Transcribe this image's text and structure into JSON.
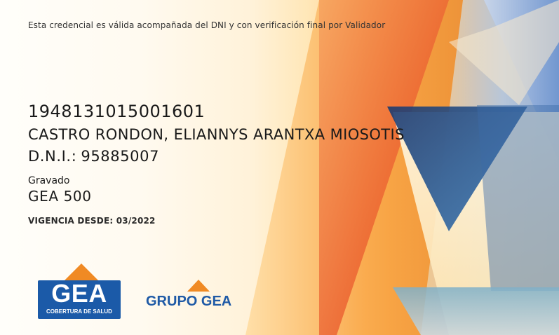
{
  "card": {
    "notice": "Esta credencial es válida acompañada del DNI y con verificación final por Validador",
    "member_number": "1948131015001601",
    "holder_name": "CASTRO RONDON, ELIANNYS ARANTXA MIOSOTIS",
    "dni_label": "D.N.I.:",
    "dni_value": "95885007",
    "plan_label": "Gravado",
    "plan_value": "GEA 500",
    "vigencia": "VIGENCIA DESDE: 03/2022"
  },
  "logos": {
    "gea": {
      "name": "GEA",
      "tagline": "COBERTURA DE SALUD"
    },
    "grupo": {
      "name": "GRUPO GEA"
    }
  },
  "colors": {
    "brand_blue": "#1b5aa8",
    "brand_orange": "#f08a24",
    "text": "#1a1a1a"
  }
}
